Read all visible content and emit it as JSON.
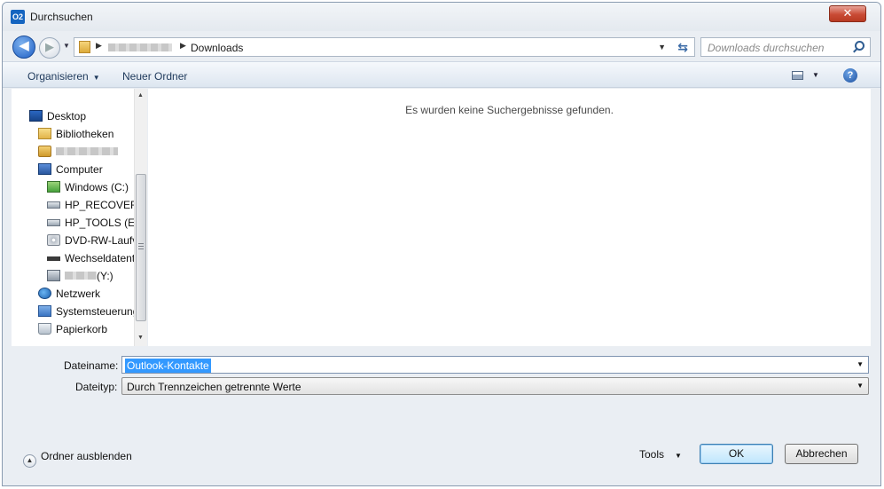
{
  "window": {
    "title": "Durchsuchen",
    "app_icon_text": "O2",
    "close_glyph": "✕"
  },
  "navigation": {
    "back_glyph": "◀",
    "forward_glyph": "▶",
    "breadcrumb_current": "Downloads",
    "search_placeholder": "Downloads durchsuchen"
  },
  "toolbar": {
    "organize_label": "Organisieren",
    "new_folder_label": "Neuer Ordner",
    "help_glyph": "?"
  },
  "sidebar": {
    "items": [
      {
        "label": "Desktop",
        "icon": "desktop-icon"
      },
      {
        "label": "Bibliotheken",
        "icon": "libraries-icon"
      },
      {
        "label": "",
        "icon": "user-folder-icon"
      },
      {
        "label": "Computer",
        "icon": "computer-icon"
      },
      {
        "label": "Windows  (C:)",
        "icon": "windows-drive-icon"
      },
      {
        "label": "HP_RECOVERY",
        "icon": "drive-icon"
      },
      {
        "label": "HP_TOOLS (E:)",
        "icon": "drive-icon"
      },
      {
        "label": "DVD-RW-Laufv",
        "icon": "dvd-drive-icon"
      },
      {
        "label": "Wechseldatent",
        "icon": "removable-drive-icon"
      },
      {
        "label": "(Y:)",
        "icon": "network-drive-icon"
      },
      {
        "label": "Netzwerk",
        "icon": "network-icon"
      },
      {
        "label": "Systemsteuerung",
        "icon": "control-panel-icon"
      },
      {
        "label": "Papierkorb",
        "icon": "recycle-bin-icon"
      }
    ]
  },
  "content": {
    "empty_message": "Es wurden keine Suchergebnisse gefunden."
  },
  "form": {
    "filename_label": "Dateiname:",
    "filename_value": "Outlook-Kontakte",
    "filetype_label": "Dateityp:",
    "filetype_value": "Durch Trennzeichen getrennte Werte"
  },
  "footer": {
    "hide_folders_label": "Ordner ausblenden",
    "tools_label": "Tools",
    "ok_label": "OK",
    "cancel_label": "Abbrechen"
  },
  "colors": {
    "selection": "#3399ff",
    "toolbar_text": "#1e395b",
    "close_button": "#c94b35"
  }
}
